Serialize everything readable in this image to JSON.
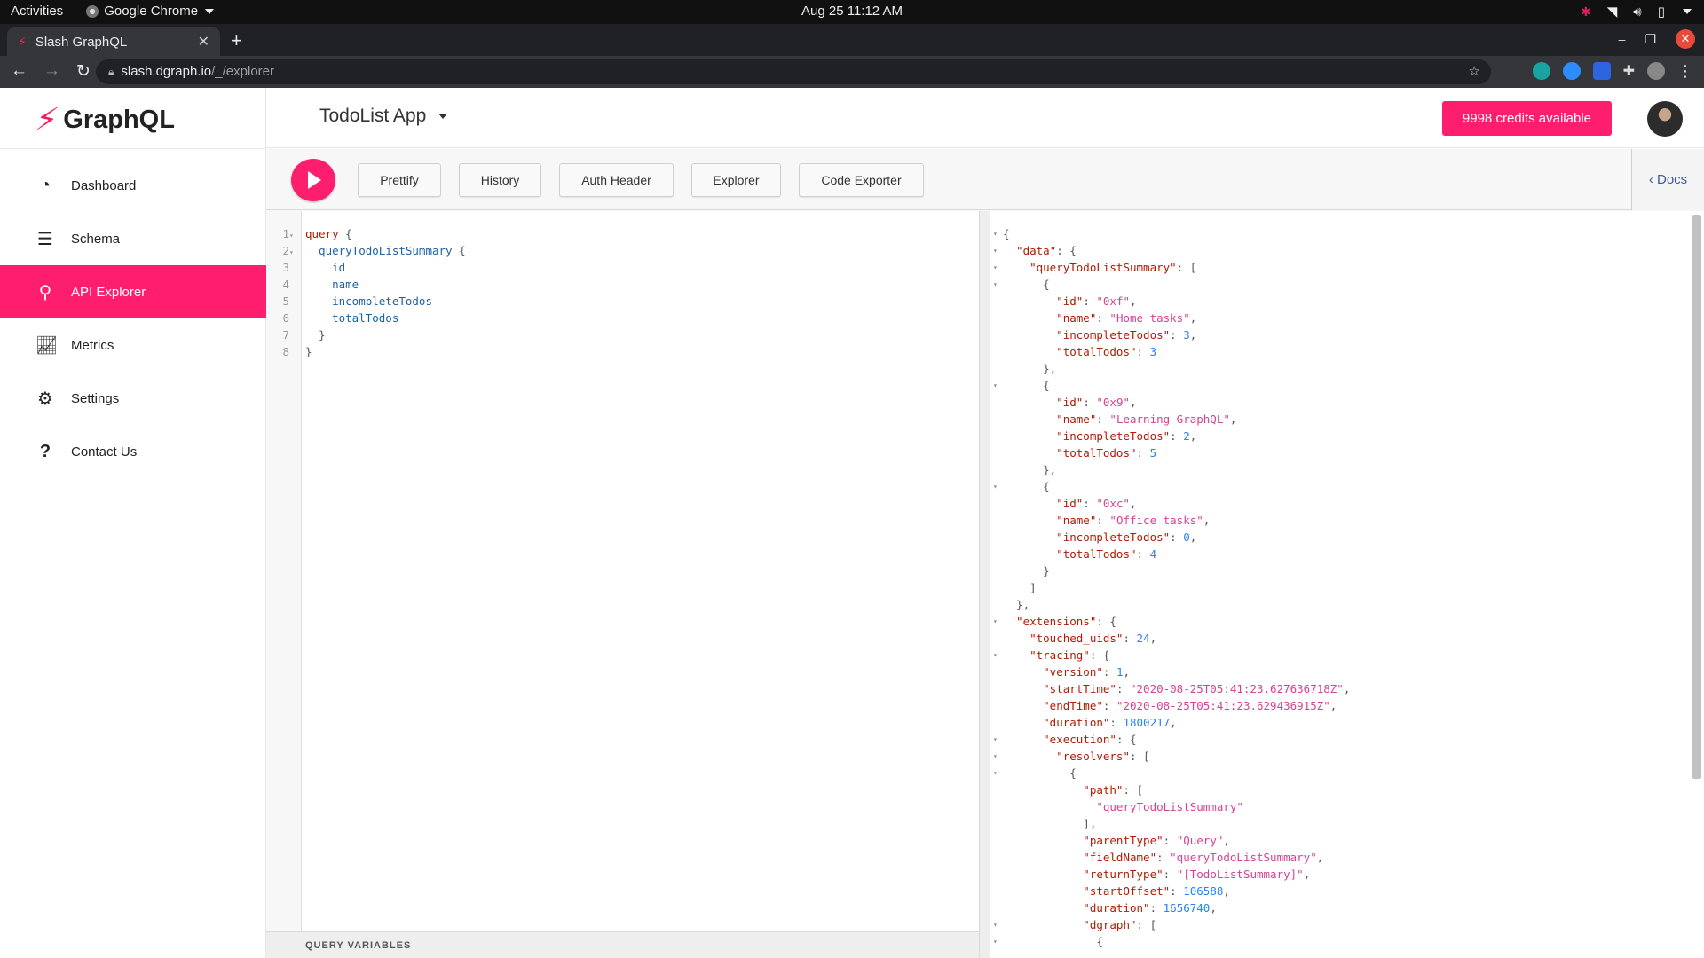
{
  "os": {
    "activities": "Activities",
    "app_name": "Google Chrome",
    "clock": "Aug 25  11:12 AM"
  },
  "browser": {
    "tab_title": "Slash GraphQL",
    "url_host": "slash.dgraph.io",
    "url_path": "/_/explorer"
  },
  "sidebar": {
    "logo_text": "GraphQL",
    "items": [
      {
        "label": "Dashboard",
        "icon": "dashboard-icon"
      },
      {
        "label": "Schema",
        "icon": "database-icon"
      },
      {
        "label": "API Explorer",
        "icon": "search-icon",
        "active": true
      },
      {
        "label": "Metrics",
        "icon": "chart-icon"
      },
      {
        "label": "Settings",
        "icon": "gear-icon"
      },
      {
        "label": "Contact Us",
        "icon": "question-icon"
      }
    ]
  },
  "header": {
    "app_name": "TodoList App",
    "credits": "9998 credits available"
  },
  "toolbar": {
    "prettify": "Prettify",
    "history": "History",
    "auth_header": "Auth Header",
    "explorer": "Explorer",
    "code_exporter": "Code Exporter",
    "docs": "Docs"
  },
  "editor": {
    "lines": [
      {
        "n": "1",
        "fold": true,
        "parts": [
          [
            "kw",
            "query"
          ],
          [
            "punct",
            " {"
          ]
        ]
      },
      {
        "n": "2",
        "fold": true,
        "parts": [
          [
            "fn",
            "  queryTodoListSummary"
          ],
          [
            "punct",
            " {"
          ]
        ]
      },
      {
        "n": "3",
        "fold": false,
        "parts": [
          [
            "prop",
            "    id"
          ]
        ]
      },
      {
        "n": "4",
        "fold": false,
        "parts": [
          [
            "prop",
            "    name"
          ]
        ]
      },
      {
        "n": "5",
        "fold": false,
        "parts": [
          [
            "prop",
            "    incompleteTodos"
          ]
        ]
      },
      {
        "n": "6",
        "fold": false,
        "parts": [
          [
            "prop",
            "    totalTodos"
          ]
        ]
      },
      {
        "n": "7",
        "fold": false,
        "parts": [
          [
            "punct",
            "  }"
          ]
        ]
      },
      {
        "n": "8",
        "fold": false,
        "parts": [
          [
            "punct",
            "}"
          ]
        ]
      }
    ],
    "query_variables_label": "QUERY VARIABLES"
  },
  "result": {
    "lines": [
      {
        "fold": true,
        "parts": [
          [
            "punct",
            "{"
          ]
        ]
      },
      {
        "fold": true,
        "parts": [
          [
            "key",
            "  \"data\""
          ],
          [
            "punct",
            ": {"
          ]
        ]
      },
      {
        "fold": true,
        "parts": [
          [
            "key",
            "    \"queryTodoListSummary\""
          ],
          [
            "punct",
            ": ["
          ]
        ]
      },
      {
        "fold": true,
        "parts": [
          [
            "punct",
            "      {"
          ]
        ]
      },
      {
        "fold": false,
        "parts": [
          [
            "key",
            "        \"id\""
          ],
          [
            "punct",
            ": "
          ],
          [
            "str",
            "\"0xf\""
          ],
          [
            "punct",
            ","
          ]
        ]
      },
      {
        "fold": false,
        "parts": [
          [
            "key",
            "        \"name\""
          ],
          [
            "punct",
            ": "
          ],
          [
            "str",
            "\"Home tasks\""
          ],
          [
            "punct",
            ","
          ]
        ]
      },
      {
        "fold": false,
        "parts": [
          [
            "key",
            "        \"incompleteTodos\""
          ],
          [
            "punct",
            ": "
          ],
          [
            "num",
            "3"
          ],
          [
            "punct",
            ","
          ]
        ]
      },
      {
        "fold": false,
        "parts": [
          [
            "key",
            "        \"totalTodos\""
          ],
          [
            "punct",
            ": "
          ],
          [
            "num",
            "3"
          ]
        ]
      },
      {
        "fold": false,
        "parts": [
          [
            "punct",
            "      },"
          ]
        ]
      },
      {
        "fold": true,
        "parts": [
          [
            "punct",
            "      {"
          ]
        ]
      },
      {
        "fold": false,
        "parts": [
          [
            "key",
            "        \"id\""
          ],
          [
            "punct",
            ": "
          ],
          [
            "str",
            "\"0x9\""
          ],
          [
            "punct",
            ","
          ]
        ]
      },
      {
        "fold": false,
        "parts": [
          [
            "key",
            "        \"name\""
          ],
          [
            "punct",
            ": "
          ],
          [
            "str",
            "\"Learning GraphQL\""
          ],
          [
            "punct",
            ","
          ]
        ]
      },
      {
        "fold": false,
        "parts": [
          [
            "key",
            "        \"incompleteTodos\""
          ],
          [
            "punct",
            ": "
          ],
          [
            "num",
            "2"
          ],
          [
            "punct",
            ","
          ]
        ]
      },
      {
        "fold": false,
        "parts": [
          [
            "key",
            "        \"totalTodos\""
          ],
          [
            "punct",
            ": "
          ],
          [
            "num",
            "5"
          ]
        ]
      },
      {
        "fold": false,
        "parts": [
          [
            "punct",
            "      },"
          ]
        ]
      },
      {
        "fold": true,
        "parts": [
          [
            "punct",
            "      {"
          ]
        ]
      },
      {
        "fold": false,
        "parts": [
          [
            "key",
            "        \"id\""
          ],
          [
            "punct",
            ": "
          ],
          [
            "str",
            "\"0xc\""
          ],
          [
            "punct",
            ","
          ]
        ]
      },
      {
        "fold": false,
        "parts": [
          [
            "key",
            "        \"name\""
          ],
          [
            "punct",
            ": "
          ],
          [
            "str",
            "\"Office tasks\""
          ],
          [
            "punct",
            ","
          ]
        ]
      },
      {
        "fold": false,
        "parts": [
          [
            "key",
            "        \"incompleteTodos\""
          ],
          [
            "punct",
            ": "
          ],
          [
            "num",
            "0"
          ],
          [
            "punct",
            ","
          ]
        ]
      },
      {
        "fold": false,
        "parts": [
          [
            "key",
            "        \"totalTodos\""
          ],
          [
            "punct",
            ": "
          ],
          [
            "num",
            "4"
          ]
        ]
      },
      {
        "fold": false,
        "parts": [
          [
            "punct",
            "      }"
          ]
        ]
      },
      {
        "fold": false,
        "parts": [
          [
            "punct",
            "    ]"
          ]
        ]
      },
      {
        "fold": false,
        "parts": [
          [
            "punct",
            "  },"
          ]
        ]
      },
      {
        "fold": true,
        "parts": [
          [
            "key",
            "  \"extensions\""
          ],
          [
            "punct",
            ": {"
          ]
        ]
      },
      {
        "fold": false,
        "parts": [
          [
            "key",
            "    \"touched_uids\""
          ],
          [
            "punct",
            ": "
          ],
          [
            "num",
            "24"
          ],
          [
            "punct",
            ","
          ]
        ]
      },
      {
        "fold": true,
        "parts": [
          [
            "key",
            "    \"tracing\""
          ],
          [
            "punct",
            ": {"
          ]
        ]
      },
      {
        "fold": false,
        "parts": [
          [
            "key",
            "      \"version\""
          ],
          [
            "punct",
            ": "
          ],
          [
            "num",
            "1"
          ],
          [
            "punct",
            ","
          ]
        ]
      },
      {
        "fold": false,
        "parts": [
          [
            "key",
            "      \"startTime\""
          ],
          [
            "punct",
            ": "
          ],
          [
            "str",
            "\"2020-08-25T05:41:23.627636718Z\""
          ],
          [
            "punct",
            ","
          ]
        ]
      },
      {
        "fold": false,
        "parts": [
          [
            "key",
            "      \"endTime\""
          ],
          [
            "punct",
            ": "
          ],
          [
            "str",
            "\"2020-08-25T05:41:23.629436915Z\""
          ],
          [
            "punct",
            ","
          ]
        ]
      },
      {
        "fold": false,
        "parts": [
          [
            "key",
            "      \"duration\""
          ],
          [
            "punct",
            ": "
          ],
          [
            "num",
            "1800217"
          ],
          [
            "punct",
            ","
          ]
        ]
      },
      {
        "fold": true,
        "parts": [
          [
            "key",
            "      \"execution\""
          ],
          [
            "punct",
            ": {"
          ]
        ]
      },
      {
        "fold": true,
        "parts": [
          [
            "key",
            "        \"resolvers\""
          ],
          [
            "punct",
            ": ["
          ]
        ]
      },
      {
        "fold": true,
        "parts": [
          [
            "punct",
            "          {"
          ]
        ]
      },
      {
        "fold": false,
        "parts": [
          [
            "key",
            "            \"path\""
          ],
          [
            "punct",
            ": ["
          ]
        ]
      },
      {
        "fold": false,
        "parts": [
          [
            "str",
            "              \"queryTodoListSummary\""
          ]
        ]
      },
      {
        "fold": false,
        "parts": [
          [
            "punct",
            "            ],"
          ]
        ]
      },
      {
        "fold": false,
        "parts": [
          [
            "key",
            "            \"parentType\""
          ],
          [
            "punct",
            ": "
          ],
          [
            "str",
            "\"Query\""
          ],
          [
            "punct",
            ","
          ]
        ]
      },
      {
        "fold": false,
        "parts": [
          [
            "key",
            "            \"fieldName\""
          ],
          [
            "punct",
            ": "
          ],
          [
            "str",
            "\"queryTodoListSummary\""
          ],
          [
            "punct",
            ","
          ]
        ]
      },
      {
        "fold": false,
        "parts": [
          [
            "key",
            "            \"returnType\""
          ],
          [
            "punct",
            ": "
          ],
          [
            "str",
            "\"[TodoListSummary]\""
          ],
          [
            "punct",
            ","
          ]
        ]
      },
      {
        "fold": false,
        "parts": [
          [
            "key",
            "            \"startOffset\""
          ],
          [
            "punct",
            ": "
          ],
          [
            "num",
            "106588"
          ],
          [
            "punct",
            ","
          ]
        ]
      },
      {
        "fold": false,
        "parts": [
          [
            "key",
            "            \"duration\""
          ],
          [
            "punct",
            ": "
          ],
          [
            "num",
            "1656740"
          ],
          [
            "punct",
            ","
          ]
        ]
      },
      {
        "fold": true,
        "parts": [
          [
            "key",
            "            \"dgraph\""
          ],
          [
            "punct",
            ": ["
          ]
        ]
      },
      {
        "fold": true,
        "parts": [
          [
            "punct",
            "              {"
          ]
        ]
      }
    ]
  }
}
